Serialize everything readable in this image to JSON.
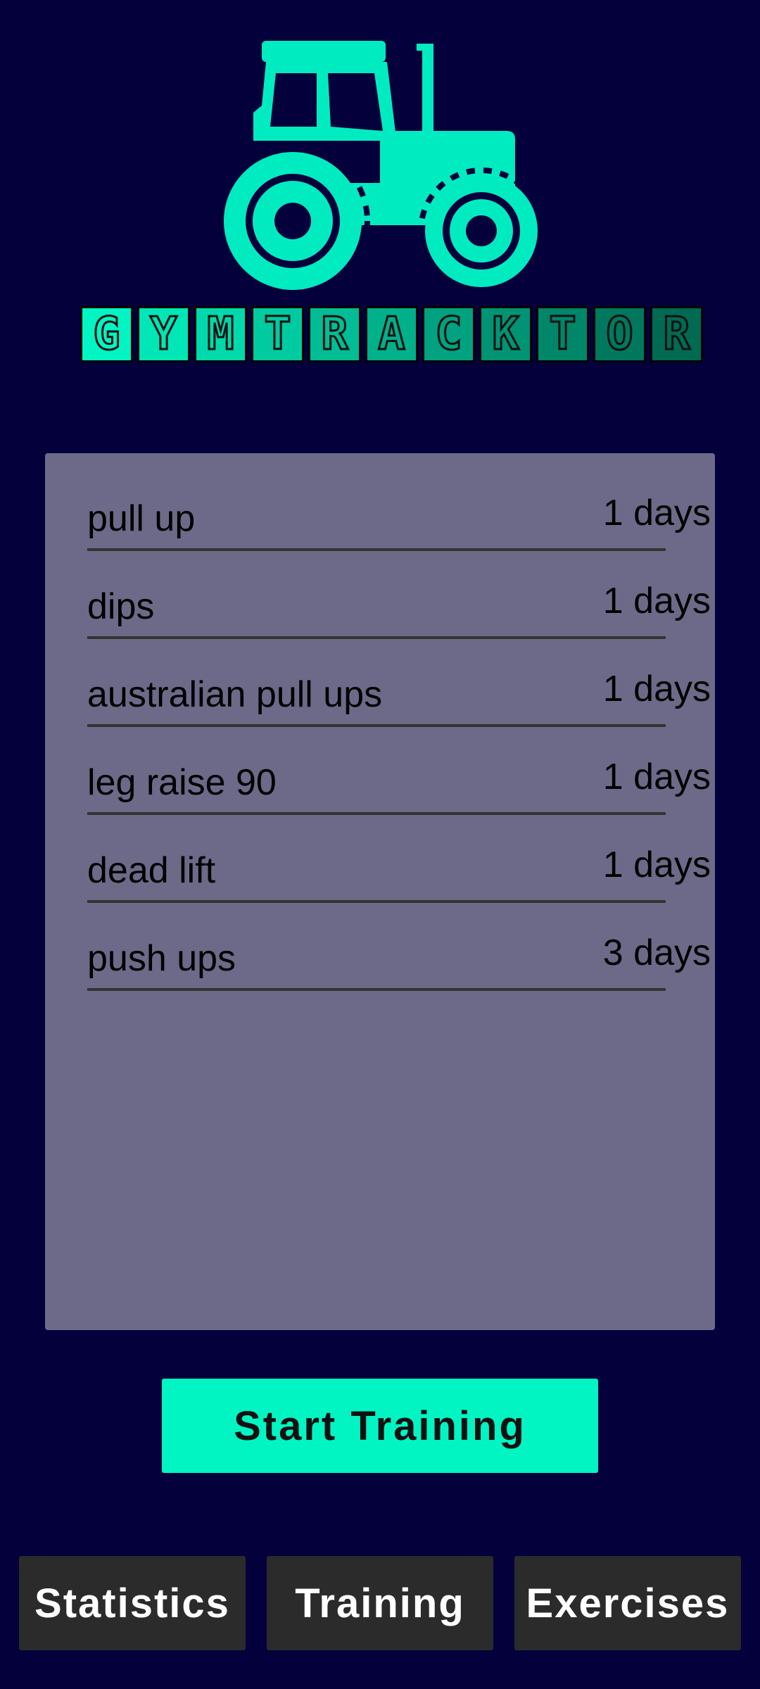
{
  "logo": {
    "brand_letters": [
      "G",
      "Y",
      "M",
      "T",
      "R",
      "A",
      "C",
      "K",
      "T",
      "O",
      "R"
    ],
    "tile_colors": [
      "#00f5c3",
      "#00e6b6",
      "#00d9ab",
      "#00cba0",
      "#00bd95",
      "#00b08a",
      "#00a27f",
      "#009474",
      "#008669",
      "#00785e",
      "#006a53"
    ],
    "tractor_color": "#00ecc0",
    "icon": "tractor-icon"
  },
  "exercises": [
    {
      "name": "pull up",
      "days": "1 days"
    },
    {
      "name": "dips",
      "days": "1 days"
    },
    {
      "name": "australian pull ups",
      "days": "1 days"
    },
    {
      "name": "leg raise 90",
      "days": "1 days"
    },
    {
      "name": "dead lift",
      "days": "1 days"
    },
    {
      "name": "push ups",
      "days": "3 days"
    }
  ],
  "start_button": {
    "label": "Start Training"
  },
  "nav": {
    "statistics": "Statistics",
    "training": "Training",
    "exercises": "Exercises"
  },
  "colors": {
    "background": "#03003b",
    "panel": "#6c6a88",
    "accent": "#00f5c3",
    "nav_button": "#2b2b2b"
  }
}
